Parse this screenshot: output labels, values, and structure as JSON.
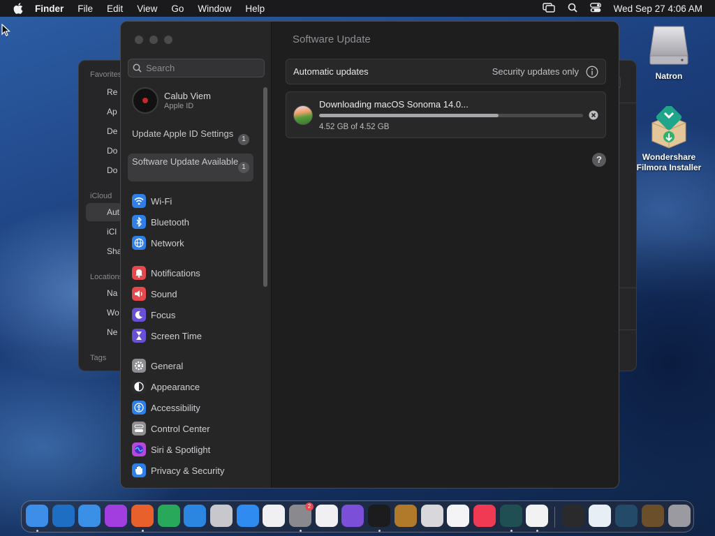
{
  "menubar": {
    "app_name": "Finder",
    "items": [
      "File",
      "Edit",
      "View",
      "Go",
      "Window",
      "Help"
    ],
    "clock": "Wed Sep 27  4:06 AM"
  },
  "finder_window": {
    "sections": [
      "Favorites",
      "iCloud",
      "Locations",
      "Tags"
    ],
    "favorites": [
      "Re",
      "Ap",
      "De",
      "Do",
      "Do"
    ],
    "icloud": [
      "Aut",
      "iCl",
      "Sha"
    ],
    "locations": [
      "Na",
      "Wo",
      "Ne"
    ]
  },
  "desktop_icons": [
    {
      "label": "Natron"
    },
    {
      "label": "Wondershare Filmora Installer"
    }
  ],
  "settings": {
    "search_placeholder": "Search",
    "account": {
      "name": "Calub Viem",
      "subtitle": "Apple ID"
    },
    "notices": [
      {
        "label": "Update Apple ID Settings",
        "badge": "1"
      },
      {
        "label": "Software Update Available",
        "badge": "1"
      }
    ],
    "nav": [
      {
        "label": "Wi-Fi",
        "icon": "wifi-icon",
        "color": "#2f7fe8"
      },
      {
        "label": "Bluetooth",
        "icon": "bluetooth-icon",
        "color": "#2f7fe8"
      },
      {
        "label": "Network",
        "icon": "globe-icon",
        "color": "#2f7fe8"
      },
      {
        "label": "Notifications",
        "icon": "bell-icon",
        "color": "#e5484d"
      },
      {
        "label": "Sound",
        "icon": "speaker-icon",
        "color": "#e5484d"
      },
      {
        "label": "Focus",
        "icon": "moon-icon",
        "color": "#6a4fd8"
      },
      {
        "label": "Screen Time",
        "icon": "hourglass-icon",
        "color": "#6a4fd8"
      },
      {
        "label": "General",
        "icon": "gear-icon",
        "color": "#8e8e93"
      },
      {
        "label": "Appearance",
        "icon": "appearance-icon",
        "color": "#2b2b2d"
      },
      {
        "label": "Accessibility",
        "icon": "accessibility-icon",
        "color": "#2f7fe8"
      },
      {
        "label": "Control Center",
        "icon": "control-center-icon",
        "color": "#8e8e93"
      },
      {
        "label": "Siri & Spotlight",
        "icon": "siri-icon",
        "color": "#b64ad8"
      },
      {
        "label": "Privacy & Security",
        "icon": "hand-icon",
        "color": "#2f7fe8"
      }
    ],
    "content": {
      "title": "Software Update",
      "automatic_updates_label": "Automatic updates",
      "automatic_updates_value": "Security updates only",
      "download_title": "Downloading macOS Sonoma 14.0...",
      "download_size": "4.52 GB of 4.52 GB",
      "download_progress": 0.68,
      "help_label": "?"
    }
  },
  "dock": {
    "apps": [
      {
        "name": "finder",
        "color": "#3d8ee8"
      },
      {
        "name": "vscode",
        "color": "#1e6fc4"
      },
      {
        "name": "safari",
        "color": "#3a8fe6"
      },
      {
        "name": "podcasts",
        "color": "#a23ee0"
      },
      {
        "name": "firefox",
        "color": "#e8612c"
      },
      {
        "name": "app-green",
        "color": "#27a85a"
      },
      {
        "name": "keynote",
        "color": "#2a86e0"
      },
      {
        "name": "script-editor",
        "color": "#c7c7cc"
      },
      {
        "name": "app-store",
        "color": "#2f8bf0"
      },
      {
        "name": "freeform",
        "color": "#f0f0f2"
      },
      {
        "name": "system-settings",
        "color": "#8a8a8e",
        "badge": "2"
      },
      {
        "name": "textedit",
        "color": "#f0f0f2"
      },
      {
        "name": "app-purple",
        "color": "#7b4fd8"
      },
      {
        "name": "terminal",
        "color": "#1c1c1e"
      },
      {
        "name": "garageband",
        "color": "#b07a2a"
      },
      {
        "name": "launchpad",
        "color": "#d7d7dc"
      },
      {
        "name": "app-pink",
        "color": "#f4f4f6"
      },
      {
        "name": "music",
        "color": "#f03a54"
      },
      {
        "name": "filmora",
        "color": "#1f4f52"
      },
      {
        "name": "chrome",
        "color": "#f2f2f2"
      }
    ],
    "right": [
      {
        "name": "preview-doc",
        "color": "#2a2a2c"
      },
      {
        "name": "doc-window",
        "color": "#e8eef5"
      },
      {
        "name": "screen-window",
        "color": "#244a6a"
      },
      {
        "name": "desktop-window",
        "color": "#6a4f2a"
      },
      {
        "name": "trash",
        "color": "#9a9aa0"
      }
    ]
  }
}
